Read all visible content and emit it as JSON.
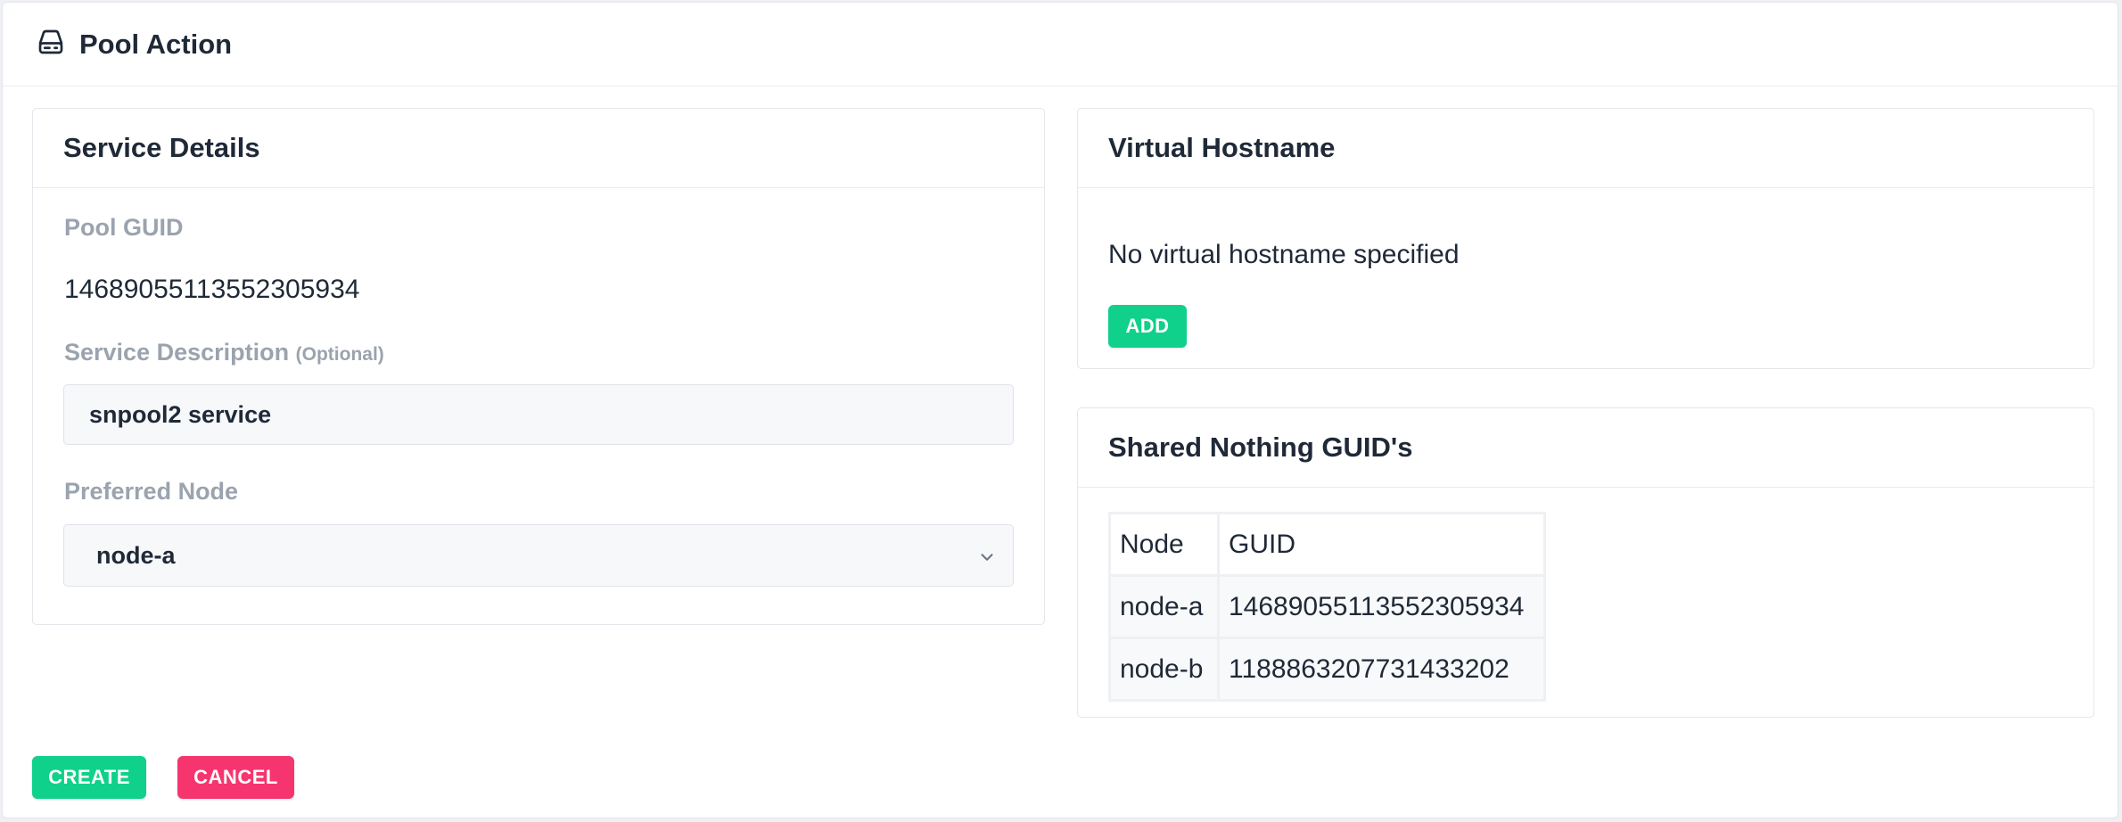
{
  "header": {
    "title": "Pool Action",
    "icon": "hard-drive-icon"
  },
  "service_details": {
    "title": "Service Details",
    "pool_guid_label": "Pool GUID",
    "pool_guid_value": "14689055113552305934",
    "description_label": "Service Description",
    "description_optional": "(Optional)",
    "description_value": "snpool2 service",
    "preferred_node_label": "Preferred Node",
    "preferred_node_value": "node-a"
  },
  "virtual_hostname": {
    "title": "Virtual Hostname",
    "empty_text": "No virtual hostname specified",
    "add_label": "ADD"
  },
  "shared_nothing": {
    "title": "Shared Nothing GUID's",
    "columns": [
      "Node",
      "GUID"
    ],
    "rows": [
      [
        "node-a",
        "14689055113552305934"
      ],
      [
        "node-b",
        "1188863207731433202"
      ]
    ]
  },
  "actions": {
    "create_label": "CREATE",
    "cancel_label": "CANCEL"
  },
  "colors": {
    "accent_green": "#10d18b",
    "accent_pink": "#f6356f",
    "muted_label": "#9aa3ae"
  }
}
